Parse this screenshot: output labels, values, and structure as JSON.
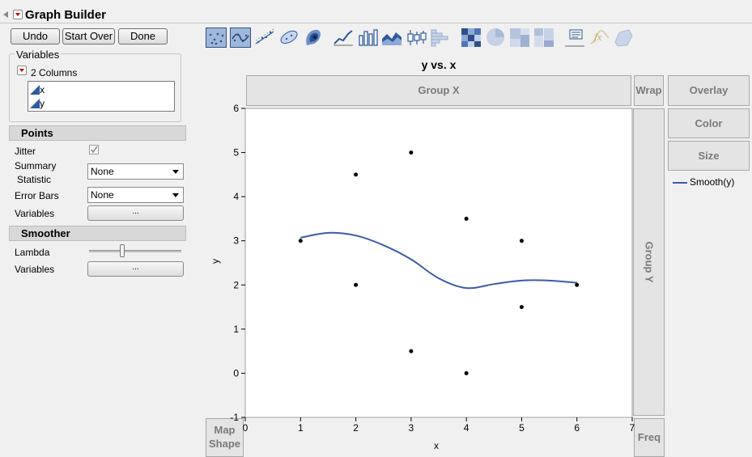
{
  "window": {
    "title": "Graph Builder"
  },
  "buttons": {
    "undo": "Undo",
    "start_over": "Start Over",
    "done": "Done"
  },
  "variables": {
    "label": "Variables",
    "count_label": "2 Columns",
    "columns": [
      "x",
      "y"
    ]
  },
  "points": {
    "title": "Points",
    "jitter_label": "Jitter",
    "jitter_checked": true,
    "summary_label_1": "Summary",
    "summary_label_2": "Statistic",
    "summary_value": "None",
    "error_bars_label": "Error Bars",
    "error_bars_value": "None",
    "variables_label": "Variables",
    "variables_button": "..."
  },
  "smoother": {
    "title": "Smoother",
    "lambda_label": "Lambda",
    "lambda_level": 0.35,
    "variables_label": "Variables",
    "variables_button": "..."
  },
  "toolbar": {
    "icons": [
      "points-icon",
      "smoother-icon",
      "line-of-fit-icon",
      "ellipse-icon",
      "contour-icon",
      "line-icon",
      "bar-icon",
      "area-icon",
      "box-plot-icon",
      "histogram-icon",
      "heatmap-icon",
      "pie-icon",
      "treemap-icon",
      "mosaic-icon",
      "caption-box-icon",
      "formula-icon",
      "map-shapes-icon"
    ],
    "selected": [
      "points-icon",
      "smoother-icon"
    ]
  },
  "graph": {
    "title": "y vs. x",
    "zones": {
      "group_x": "Group X",
      "wrap": "Wrap",
      "overlay": "Overlay",
      "color": "Color",
      "size": "Size",
      "group_y": "Group Y",
      "map_shape_1": "Map",
      "map_shape_2": "Shape",
      "freq": "Freq"
    },
    "legend": {
      "label": "Smooth(y)",
      "color": "#3a5ca8"
    }
  },
  "chart_data": {
    "type": "scatter",
    "title": "y vs. x",
    "xlabel": "x",
    "ylabel": "y",
    "xlim": [
      0,
      7
    ],
    "ylim": [
      -1,
      6
    ],
    "xticks": [
      "0",
      "1",
      "2",
      "3",
      "4",
      "5",
      "6",
      "7"
    ],
    "yticks": [
      "-1",
      "0",
      "1",
      "2",
      "3",
      "4",
      "5",
      "6"
    ],
    "points": [
      {
        "x": 1,
        "y": 3
      },
      {
        "x": 2,
        "y": 4.5
      },
      {
        "x": 2,
        "y": 2
      },
      {
        "x": 3,
        "y": 5
      },
      {
        "x": 3,
        "y": 0.5
      },
      {
        "x": 4,
        "y": 3.5
      },
      {
        "x": 4,
        "y": 0
      },
      {
        "x": 5,
        "y": 3
      },
      {
        "x": 5,
        "y": 1.5
      },
      {
        "x": 6,
        "y": 2
      }
    ],
    "series": [
      {
        "name": "Smooth(y)",
        "color": "#3a5ca8",
        "x": [
          1,
          1.5,
          2,
          2.5,
          3,
          3.5,
          4,
          4.5,
          5,
          5.5,
          6
        ],
        "values": [
          3.07,
          3.18,
          3.12,
          2.9,
          2.58,
          2.15,
          1.93,
          2.02,
          2.1,
          2.1,
          2.05
        ]
      }
    ],
    "grid": false
  }
}
